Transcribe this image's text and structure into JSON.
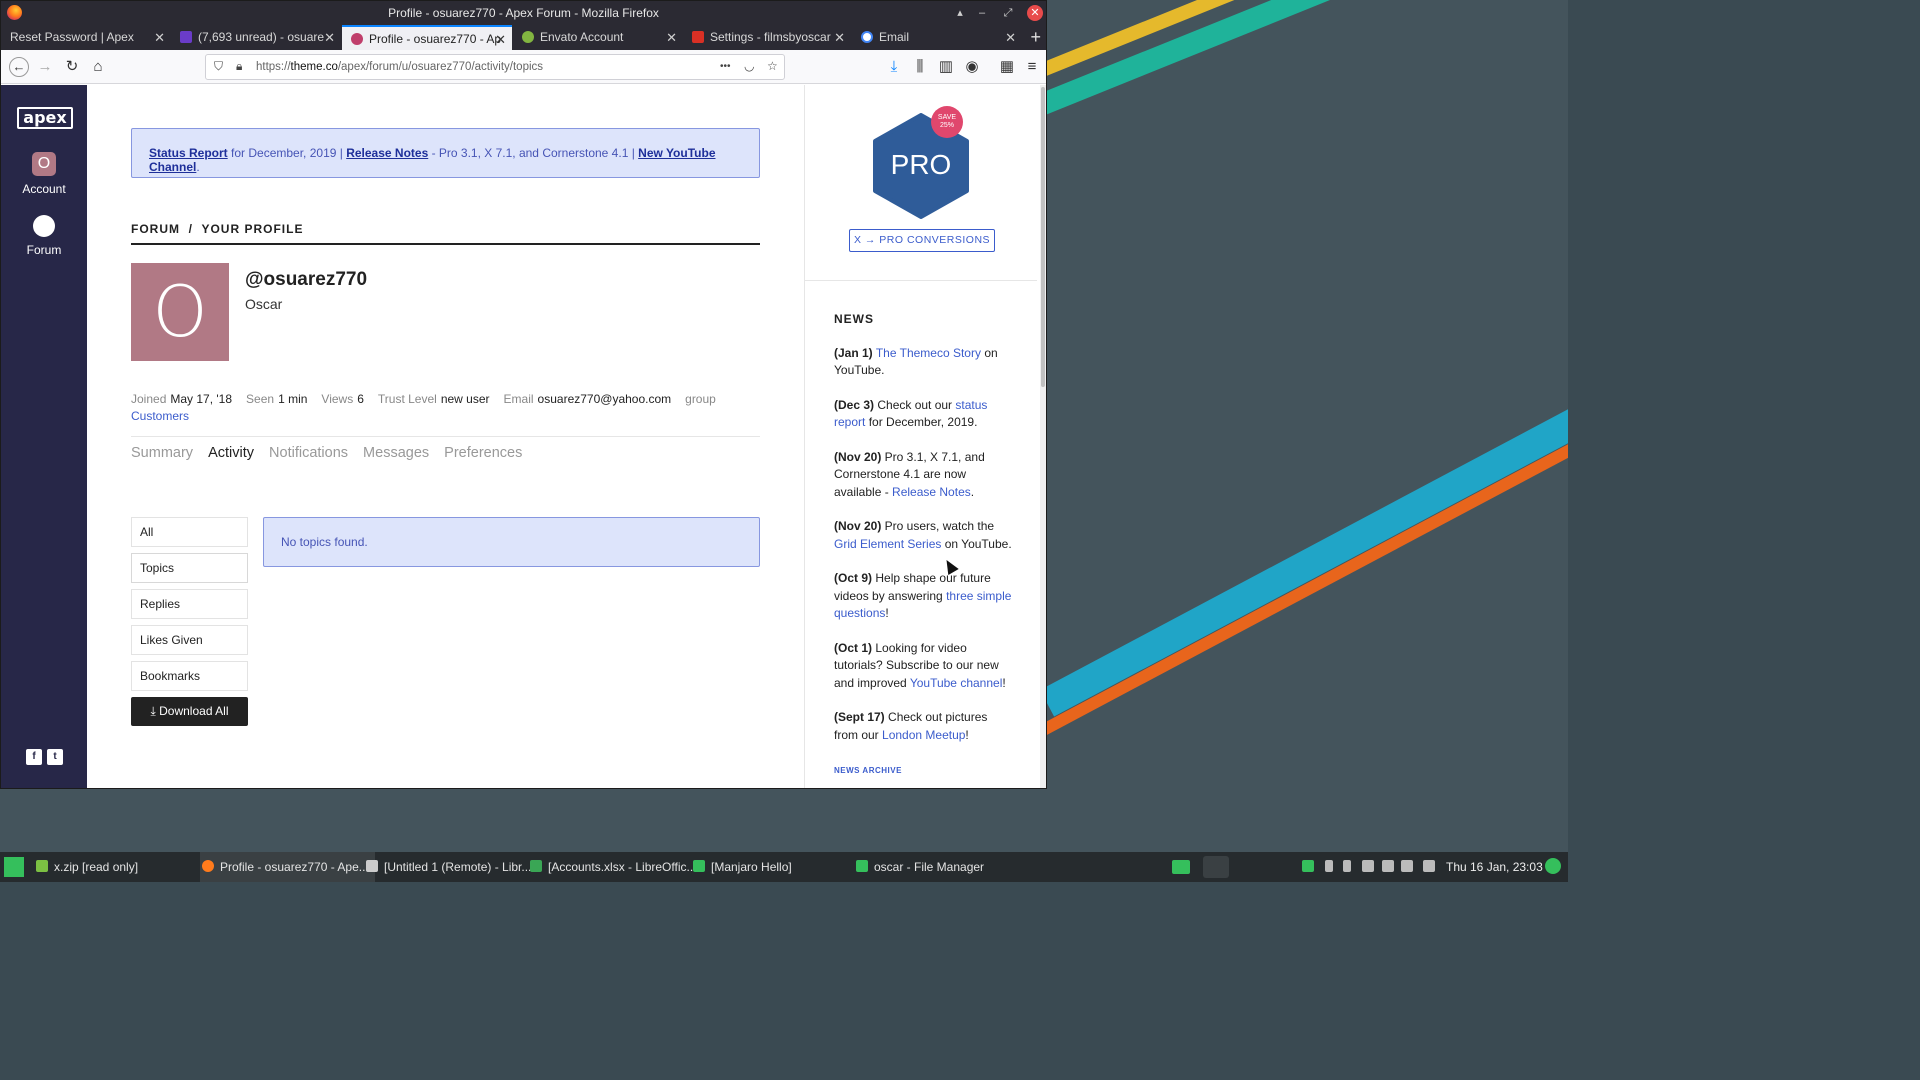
{
  "window": {
    "title": "Profile - osuarez770 - Apex Forum - Mozilla Firefox",
    "buttons": [
      "▴",
      "–",
      "⤢",
      "✕"
    ]
  },
  "tabs": [
    {
      "label": "Reset Password | Apex",
      "icon_color": "#2b2a33"
    },
    {
      "label": "(7,693 unread) - osuare",
      "icon_color": "#6a3cc9"
    },
    {
      "label": "Profile - osuarez770 - Ap",
      "icon_color": "#c03e6b"
    },
    {
      "label": "Envato Account",
      "icon_color": "#82b541"
    },
    {
      "label": "Settings - filmsbyoscar",
      "icon_color": "#d93025"
    },
    {
      "label": "Email",
      "icon_color": "#ffffff"
    }
  ],
  "navbar": {
    "url_prefix": "https://",
    "url_domain": "theme.co",
    "url_path": "/apex/forum/u/osuarez770/activity/topics",
    "more": "•••"
  },
  "sidenav": {
    "logo": "apex",
    "account_label": "Account",
    "account_initial": "O",
    "forum_label": "Forum",
    "social": [
      "f",
      "t"
    ]
  },
  "notice": {
    "status_report": "Status Report",
    "text1": " for December, 2019 | ",
    "release_notes": "Release Notes",
    "text2": " - Pro 3.1, X 7.1, and Cornerstone 4.1 | ",
    "youtube": "New YouTube Channel",
    "text3": "."
  },
  "breadcrumb": "FORUM  /  YOUR PROFILE",
  "profile": {
    "initial": "O",
    "username": "@osuarez770",
    "name": "Oscar",
    "joined_label": "Joined",
    "joined": "May 17, '18",
    "seen_label": "Seen",
    "seen": "1 min",
    "views_label": "Views",
    "views": "6",
    "trust_label": "Trust Level",
    "trust": "new user",
    "email_label": "Email",
    "email": "osuarez770@yahoo.com",
    "group_label": "group",
    "group": "Customers"
  },
  "profile_tabs": [
    "Summary",
    "Activity",
    "Notifications",
    "Messages",
    "Preferences"
  ],
  "filters": [
    "All",
    "Topics",
    "Replies",
    "Likes Given",
    "Bookmarks"
  ],
  "download_label": "Download All",
  "empty_message": "No topics found.",
  "promo": {
    "logo": "PRO",
    "save": "SAVE",
    "save_pct": "25%",
    "conversions": "X → PRO CONVERSIONS"
  },
  "news": {
    "heading": "NEWS",
    "items": [
      {
        "date": "(Jan 1)",
        "pre": " ",
        "link": "The Themeco Story",
        "post": " on YouTube."
      },
      {
        "date": "(Dec 3)",
        "pre": " Check out our ",
        "link": "status report",
        "post": " for December, 2019."
      },
      {
        "date": "(Nov 20)",
        "pre": " Pro 3.1, X 7.1, and Cornerstone 4.1 are now available - ",
        "link": "Release Notes",
        "post": "."
      },
      {
        "date": "(Nov 20)",
        "pre": " Pro users, watch the ",
        "link": "Grid Element Series",
        "post": " on YouTube."
      },
      {
        "date": "(Oct 9)",
        "pre": " Help shape our future videos by answering ",
        "link": "three simple questions",
        "post": "!"
      },
      {
        "date": "(Oct 1)",
        "pre": " Looking for video tutorials? Subscribe to our new and improved ",
        "link": "YouTube channel",
        "post": "!"
      },
      {
        "date": "(Sept 17)",
        "pre": " Check out pictures from our ",
        "link": "London Meetup",
        "post": "!"
      }
    ],
    "archive": "NEWS ARCHIVE"
  },
  "taskbar": {
    "items": [
      {
        "label": "x.zip [read only]",
        "icon_color": "#7cc043"
      },
      {
        "label": "Profile - osuarez770 - Ape...",
        "icon_color": "#ff7b1c"
      },
      {
        "label": "[Untitled 1 (Remote) - Libr...",
        "icon_color": "#cccccc"
      },
      {
        "label": "[Accounts.xlsx - LibreOffic...",
        "icon_color": "#3aa655"
      },
      {
        "label": "[Manjaro Hello]",
        "icon_color": "#35bf5c"
      },
      {
        "label": "oscar - File Manager",
        "icon_color": "#35bf5c"
      }
    ],
    "clock": "Thu 16 Jan, 23:03"
  },
  "colors": {
    "accent": "#3b5ccc",
    "sidenav": "#272748",
    "pro_blue": "#2f5c99",
    "save_pink": "#e0476d",
    "avatar": "#b17985"
  }
}
